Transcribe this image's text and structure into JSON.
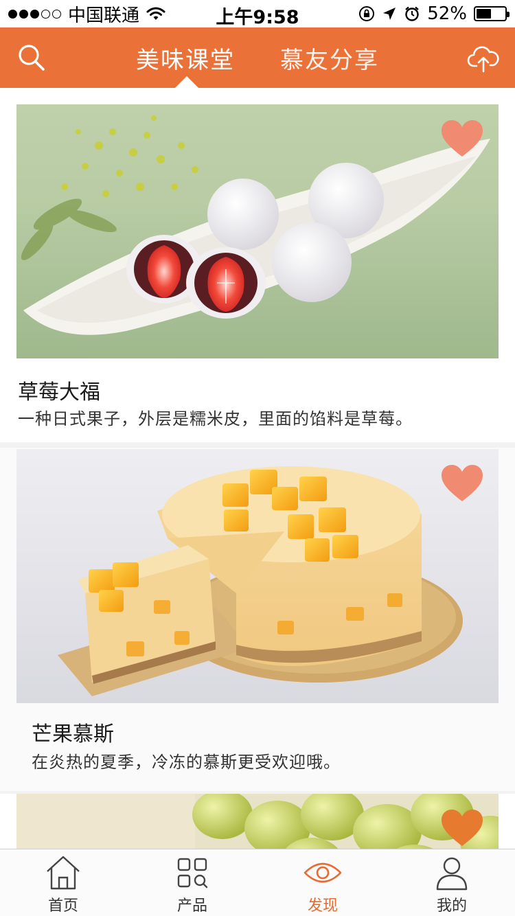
{
  "status_bar": {
    "carrier": "中国联通",
    "time": "上午9:58",
    "battery_percent": "52%",
    "battery_level": 0.52,
    "signal_bars_filled": 3,
    "signal_bars_total": 5
  },
  "header": {
    "tabs": [
      {
        "label": "美味课堂",
        "active": true
      },
      {
        "label": "慕友分享",
        "active": false
      }
    ],
    "left_icon": "search-icon",
    "right_icon": "cloud-upload-icon"
  },
  "feed": {
    "items": [
      {
        "title": "草莓大福",
        "description": "一种日式果子，外层是糯米皮，里面的馅料是草莓。",
        "favorite_icon": "heart-icon"
      },
      {
        "title": "芒果慕斯",
        "description": "在炎热的夏季，冷冻的慕斯更受欢迎哦。",
        "favorite_icon": "heart-icon"
      },
      {
        "title": "",
        "description": "",
        "favorite_icon": "heart-icon"
      }
    ]
  },
  "tab_bar": {
    "items": [
      {
        "label": "首页",
        "icon": "home-icon",
        "active": false
      },
      {
        "label": "产品",
        "icon": "grid-search-icon",
        "active": false
      },
      {
        "label": "发现",
        "icon": "eye-icon",
        "active": true
      },
      {
        "label": "我的",
        "icon": "user-icon",
        "active": false
      }
    ]
  },
  "colors": {
    "brand": "#ea7138",
    "heart": "#f08a70",
    "tab_active": "#e86a30"
  }
}
